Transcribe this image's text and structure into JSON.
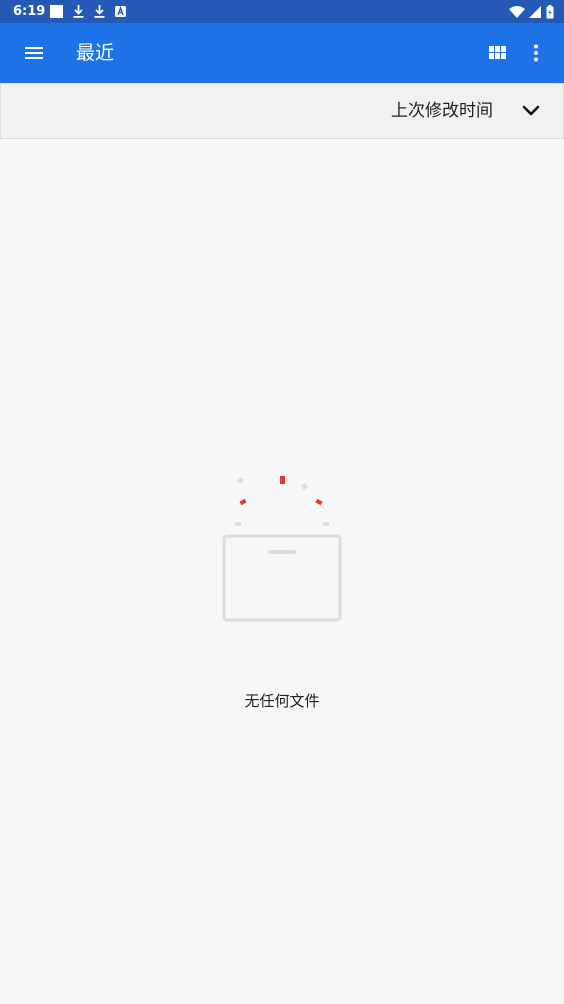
{
  "status_bar": {
    "time": "6:19",
    "icons_left": [
      "square-notification-icon",
      "download-icon",
      "download-icon",
      "a-notification-icon"
    ],
    "icons_right": [
      "wifi-icon",
      "cell-signal-icon",
      "battery-icon"
    ]
  },
  "app_bar": {
    "title": "最近",
    "menu_icon": "hamburger-menu-icon",
    "grid_icon": "grid-view-icon",
    "more_icon": "more-vert-icon"
  },
  "sort": {
    "label": "上次修改时间",
    "toggle_icon": "chevron-down-icon"
  },
  "empty_state": {
    "message": "无任何文件",
    "icon": "empty-box-icon"
  },
  "colors": {
    "status_bar": "#2559b8",
    "app_bar": "#1e73e8",
    "background": "#f7f7f7",
    "accent_red": "#e8392e",
    "illustration_gray": "#dadce0"
  }
}
